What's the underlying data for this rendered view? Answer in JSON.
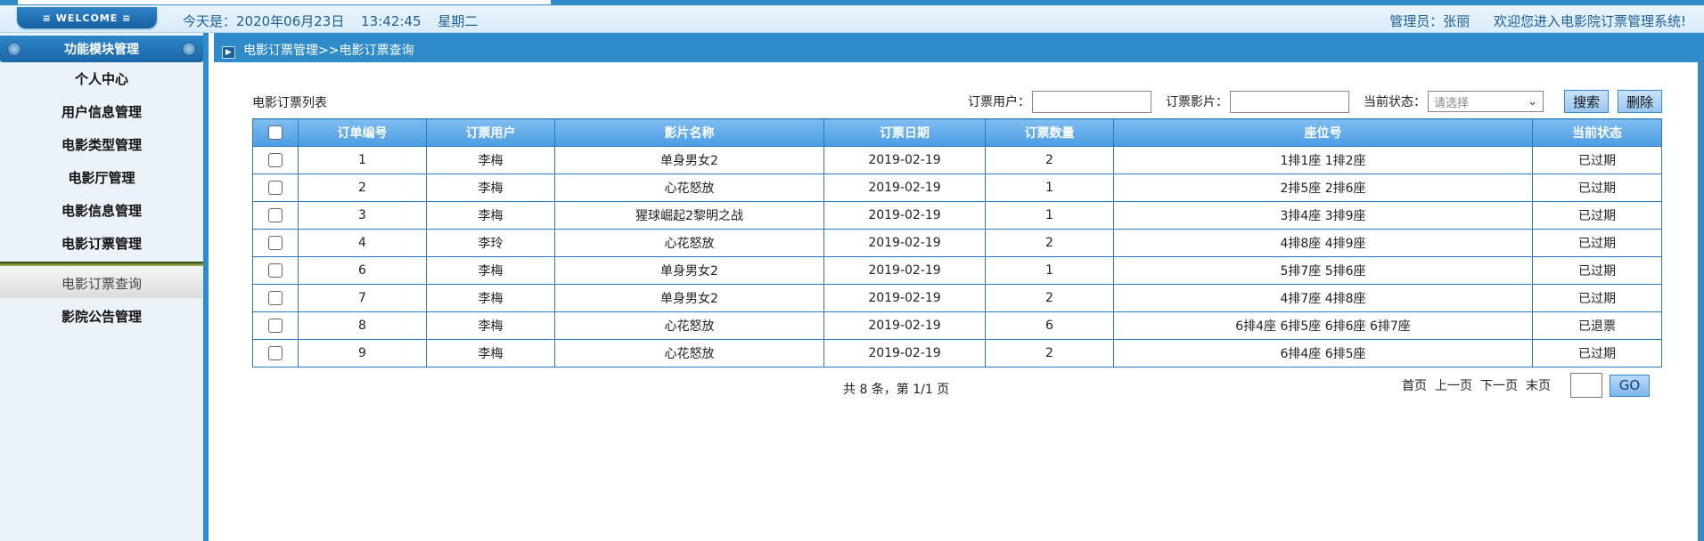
{
  "topbar": {
    "welcome": "≡ WELCOME ≡",
    "date_label": "今天是：2020年06月23日",
    "time": "13:42:45",
    "weekday": "星期二",
    "admin": "管理员：张丽",
    "greeting": "欢迎您进入电影院订票管理系统!"
  },
  "sidebar": {
    "title": "功能模块管理",
    "items": [
      {
        "label": "个人中心"
      },
      {
        "label": "用户信息管理"
      },
      {
        "label": "电影类型管理"
      },
      {
        "label": "电影厅管理"
      },
      {
        "label": "电影信息管理"
      },
      {
        "label": "电影订票管理"
      }
    ],
    "active_sub": "电影订票查询",
    "last_item": "影院公告管理"
  },
  "main": {
    "breadcrumb": "电影订票管理>>电影订票查询",
    "list_title": "电影订票列表",
    "search": {
      "user_label": "订票用户：",
      "user_value": "",
      "movie_label": "订票影片：",
      "movie_value": "",
      "status_label": "当前状态：",
      "status_placeholder": "请选择",
      "search_button": "搜索",
      "delete_button": "删除"
    }
  },
  "table": {
    "columns": [
      "订单编号",
      "订票用户",
      "影片名称",
      "订票日期",
      "订票数量",
      "座位号",
      "当前状态"
    ],
    "rows": [
      [
        "1",
        "李梅",
        "单身男女2",
        "2019-02-19",
        "2",
        "1排1座 1排2座",
        "已过期"
      ],
      [
        "2",
        "李梅",
        "心花怒放",
        "2019-02-19",
        "1",
        "2排5座 2排6座",
        "已过期"
      ],
      [
        "3",
        "李梅",
        "猩球崛起2黎明之战",
        "2019-02-19",
        "1",
        "3排4座 3排9座",
        "已过期"
      ],
      [
        "4",
        "李玲",
        "心花怒放",
        "2019-02-19",
        "2",
        "4排8座 4排9座",
        "已过期"
      ],
      [
        "6",
        "李梅",
        "单身男女2",
        "2019-02-19",
        "1",
        "5排7座 5排6座",
        "已过期"
      ],
      [
        "7",
        "李梅",
        "单身男女2",
        "2019-02-19",
        "2",
        "4排7座 4排8座",
        "已过期"
      ],
      [
        "8",
        "李梅",
        "心花怒放",
        "2019-02-19",
        "6",
        "6排4座 6排5座 6排6座 6排7座",
        "已退票"
      ],
      [
        "9",
        "李梅",
        "心花怒放",
        "2019-02-19",
        "2",
        "6排4座 6排5座",
        "已过期"
      ]
    ]
  },
  "pager": {
    "info": "共 8 条，第 1/1 页",
    "first": "首页",
    "prev": "上一页",
    "next": "下一页",
    "last": "末页",
    "go": "GO"
  },
  "colors": {
    "accent": "#2f8bc9",
    "header_blue": "#4b9ce4",
    "text_blue": "#1c5f95"
  }
}
